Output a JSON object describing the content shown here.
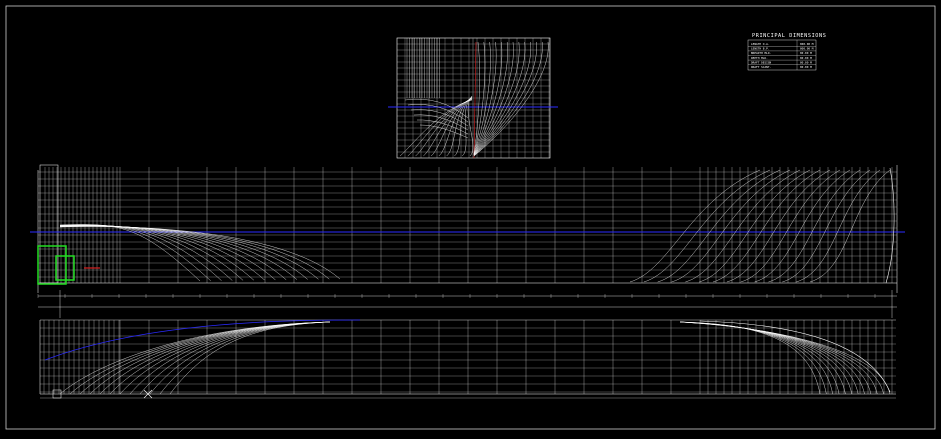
{
  "colors": {
    "background": "#000000",
    "lines": "#ffffff",
    "waterline": "#2b2bff",
    "highlight_green": "#22dd22",
    "highlight_red": "#dd2222"
  },
  "dimensions_table": {
    "title": "PRINCIPAL DIMENSIONS",
    "rows": [
      {
        "label": "LENGTH O.A.",
        "value": "000.00 M"
      },
      {
        "label": "LENGTH B.P.",
        "value": "000.00 M"
      },
      {
        "label": "BREADTH MLD.",
        "value": "00.00 M"
      },
      {
        "label": "DEPTH MLD.",
        "value": "00.00 M"
      },
      {
        "label": "DRAFT DESIGN",
        "value": "00.00 M"
      },
      {
        "label": "DRAFT SCANT.",
        "value": "00.00 M"
      }
    ]
  },
  "views": {
    "body_plan": "body-plan",
    "profile": "sheer-plan",
    "half_breadth": "half-breadth-plan"
  }
}
